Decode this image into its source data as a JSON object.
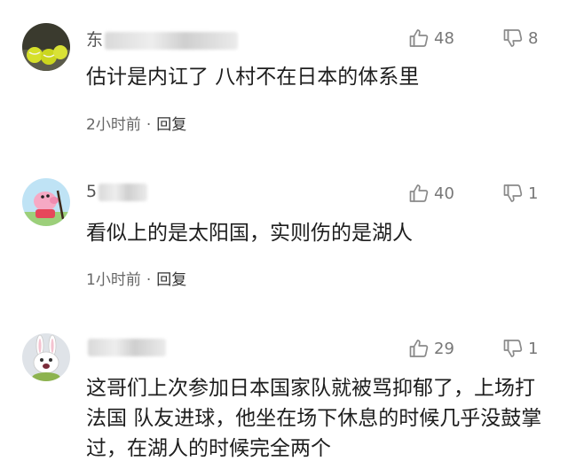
{
  "comments": [
    {
      "username": "东",
      "text": "估计是内讧了 八村不在日本的体系里",
      "time": "2小时前",
      "reply": "回复",
      "likes": "48",
      "dislikes": "8",
      "avatar": "tennis-balls-avatar"
    },
    {
      "username": "5",
      "text": "看似上的是太阳国，实则伤的是湖人",
      "time": "1小时前",
      "reply": "回复",
      "likes": "40",
      "dislikes": "1",
      "avatar": "pink-pig-avatar"
    },
    {
      "username": "",
      "text": "这哥们上次参加日本国家队就被骂抑郁了，上场打法国 队友进球，他坐在场下休息的时候几乎没鼓掌过，在湖人的时候完全两个",
      "time": "",
      "reply": "",
      "likes": "29",
      "dislikes": "1",
      "avatar": "white-rabbit-avatar"
    }
  ],
  "separator": "·",
  "colors": {
    "text": "#1e1e1e",
    "meta": "#666666",
    "icon": "#8a8a8a"
  }
}
